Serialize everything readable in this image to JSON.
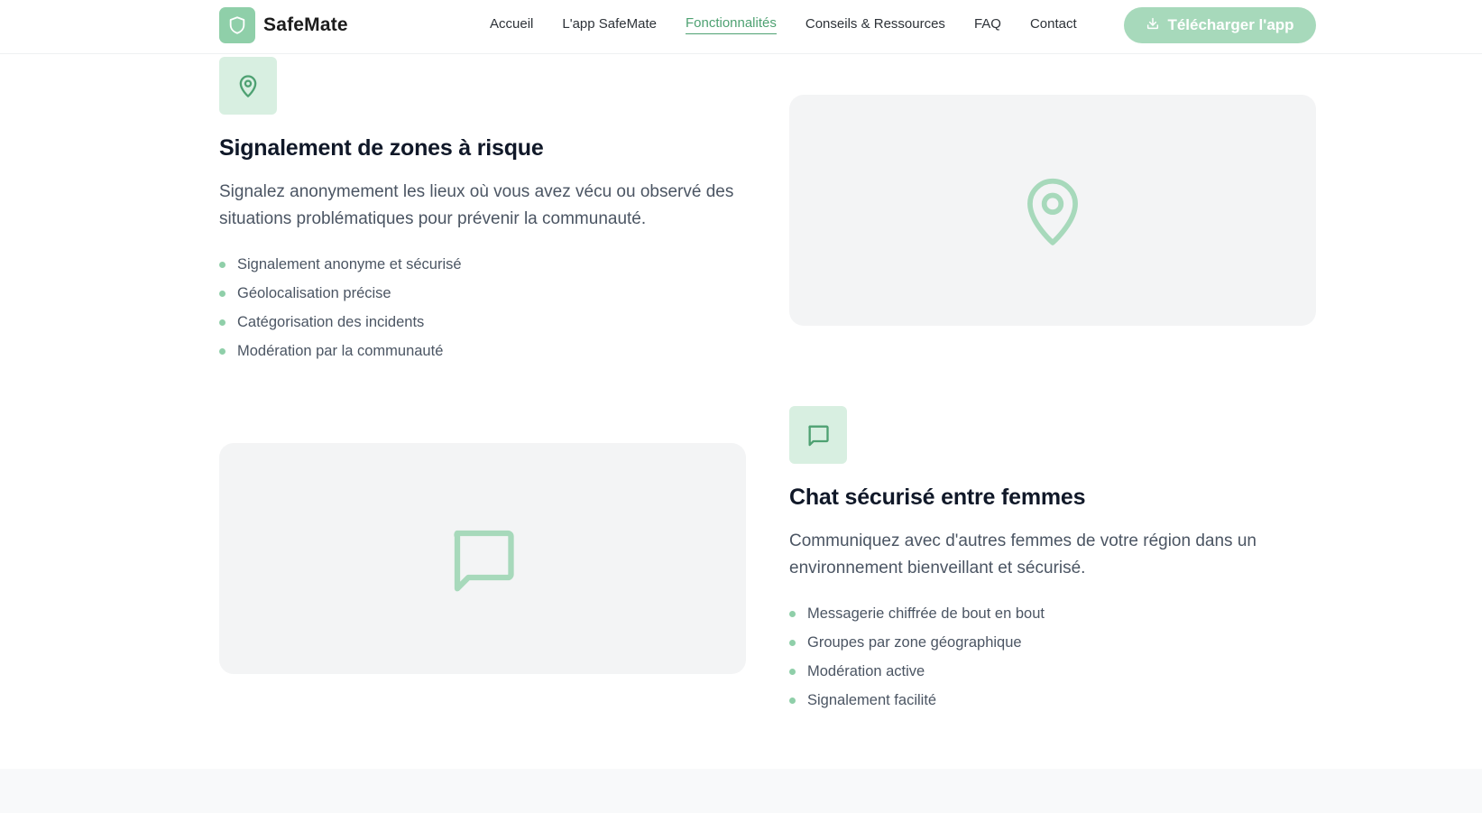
{
  "brand": {
    "name": "SafeMate",
    "logo_icon": "shield-icon"
  },
  "nav": {
    "items": [
      {
        "label": "Accueil",
        "active": false
      },
      {
        "label": "L'app SafeMate",
        "active": false
      },
      {
        "label": "Fonctionnalités",
        "active": true
      },
      {
        "label": "Conseils & Ressources",
        "active": false
      },
      {
        "label": "FAQ",
        "active": false
      },
      {
        "label": "Contact",
        "active": false
      }
    ],
    "cta_label": "Télécharger l'app",
    "cta_icon": "download-icon"
  },
  "features": [
    {
      "icon": "map-pin-icon",
      "title": "Signalement de zones à risque",
      "description": "Signalez anonymement les lieux où vous avez vécu ou observé des situations problématiques pour prévenir la communauté.",
      "points": [
        "Signalement anonyme et sécurisé",
        "Géolocalisation précise",
        "Catégorisation des incidents",
        "Modération par la communauté"
      ]
    },
    {
      "icon": "message-square-icon",
      "title": "Chat sécurisé entre femmes",
      "description": "Communiquez avec d'autres femmes de votre région dans un environnement bienveillant et sécurisé.",
      "points": [
        "Messagerie chiffrée de bout en bout",
        "Groupes par zone géographique",
        "Modération active",
        "Signalement facilité"
      ]
    }
  ],
  "colors": {
    "accent": "#4ea172",
    "accent_light": "#8fcfa9",
    "cta_bg": "#a7d9bb",
    "tile_bg": "#d8efe1",
    "illustration_bg": "#f3f4f5"
  }
}
